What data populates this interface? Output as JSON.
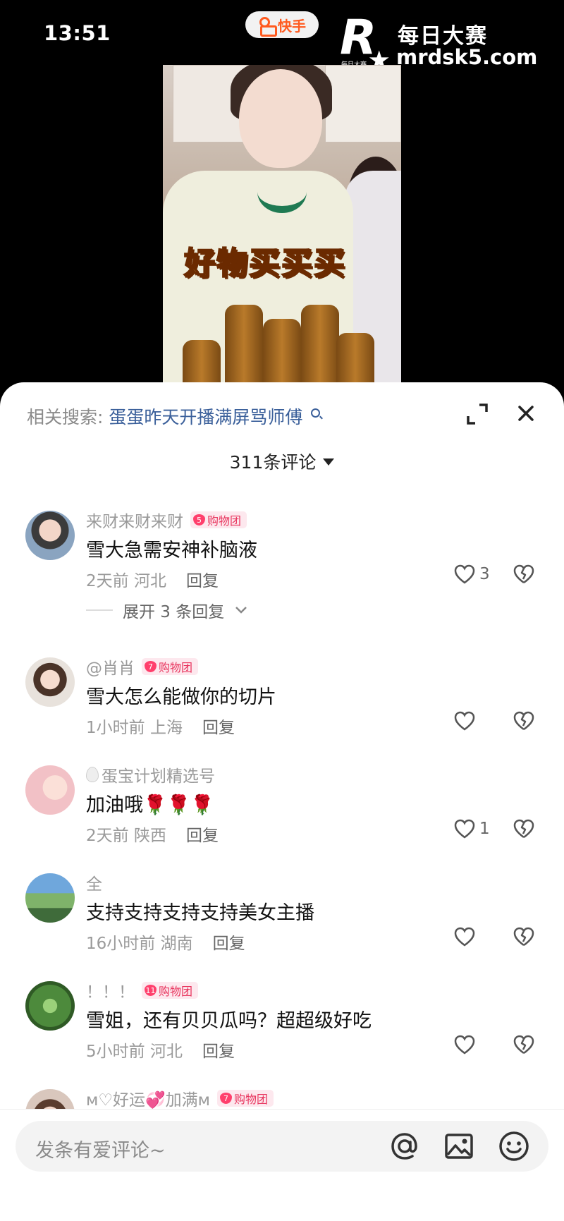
{
  "status_bar": {
    "time": "13:51"
  },
  "app_pill": {
    "name": "快手"
  },
  "watermark": {
    "title": "每日大赛",
    "url": "mrdsk5.com",
    "logo_letter": "R",
    "logo_small": "每日大赛"
  },
  "video": {
    "caption": "好物买买买"
  },
  "sheet": {
    "related_label": "相关搜索:",
    "related_query": "蛋蛋昨天开播满屏骂师傅",
    "comment_count": "311条评论"
  },
  "comments": [
    {
      "user": "来财来财来财",
      "badge_level": "5",
      "badge": "购物团",
      "text": "雪大急需安神补脑液",
      "time": "2天前 河北",
      "reply": "回复",
      "likes": "3",
      "expand": "展开 3 条回复",
      "avatar_color": "#8aa4c0"
    },
    {
      "user": "@肖肖",
      "badge_level": "7",
      "badge": "购物团",
      "text": "雪大怎么能做你的切片",
      "time": "1小时前 上海",
      "reply": "回复",
      "likes": "",
      "avatar_color": "#e4c9b8"
    },
    {
      "user": "蛋宝计划精选号",
      "badge_level": "",
      "badge": "",
      "text": "加油哦🌹🌹🌹",
      "time": "2天前 陕西",
      "reply": "回复",
      "likes": "1",
      "avatar_color": "#f2c1c6"
    },
    {
      "user": "全",
      "badge_level": "",
      "badge": "",
      "text": "支持支持支持支持美女主播",
      "time": "16小时前 湖南",
      "reply": "回复",
      "likes": "",
      "avatar_color": "#4f8bc4"
    },
    {
      "user": "！！！",
      "badge_level": "11",
      "badge": "购物团",
      "text": "雪姐，还有贝贝瓜吗？超超级好吃",
      "time": "5小时前 河北",
      "reply": "回复",
      "likes": "",
      "avatar_color": "#4d8a3c"
    },
    {
      "user": "ᴍ♡好运💞加满ᴍ",
      "badge_level": "7",
      "badge": "购物团",
      "avatar_color": "#d9c7bd"
    }
  ],
  "input": {
    "placeholder": "发条有爱评论~"
  },
  "icons": [
    "expand-icon",
    "close-icon",
    "heart-icon",
    "heart-broken-icon",
    "at-icon",
    "image-icon",
    "emoji-icon",
    "search-icon",
    "chevron-down-icon"
  ]
}
